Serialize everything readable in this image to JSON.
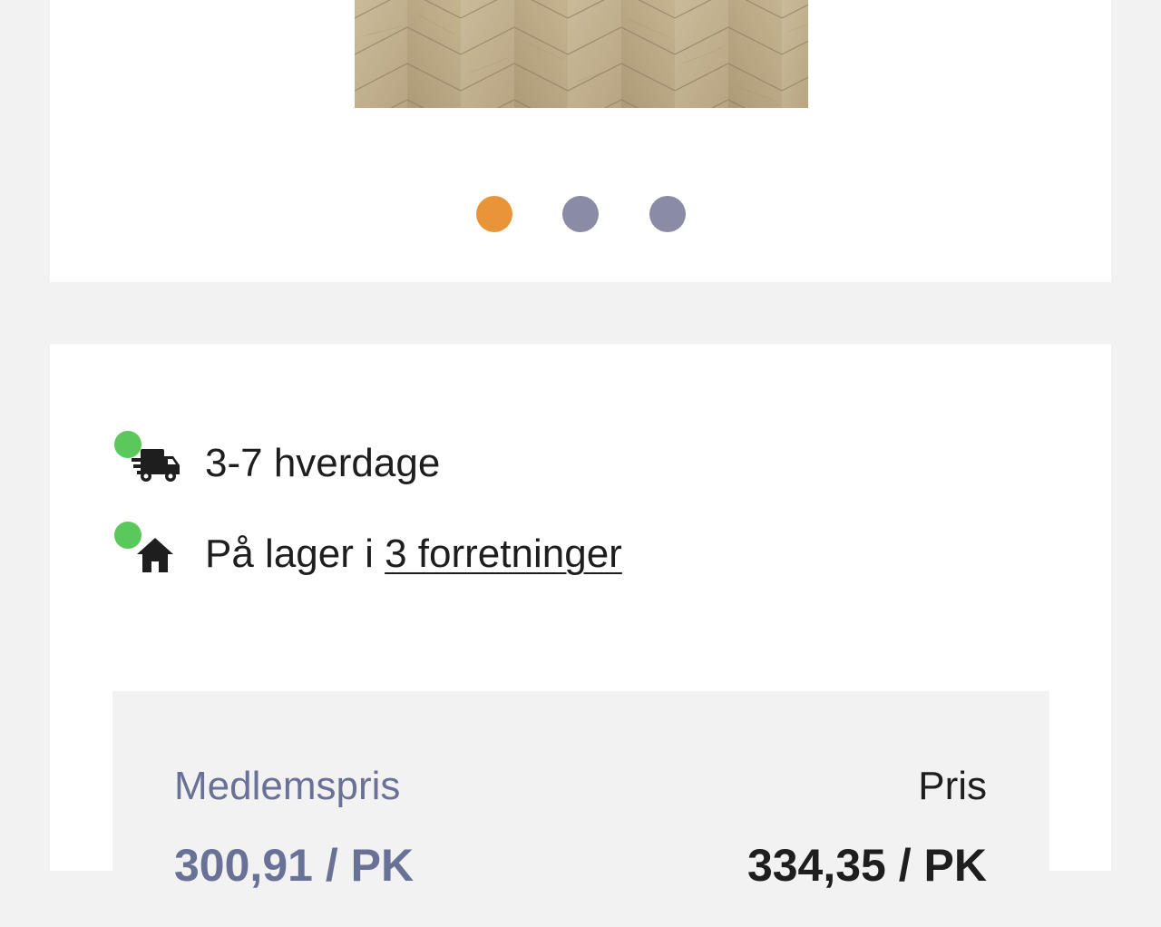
{
  "gallery": {
    "image_alt": "Herringbone oak floor",
    "dots": [
      {
        "active": true,
        "color": "#e8953a"
      },
      {
        "active": false,
        "color": "#8a8ca6"
      },
      {
        "active": false,
        "color": "#8a8ca6"
      }
    ]
  },
  "availability": {
    "status_color": "#5ac85a",
    "delivery": {
      "icon": "truck-icon",
      "text": "3-7 hverdage"
    },
    "stock": {
      "icon": "house-icon",
      "prefix": "På lager i ",
      "link_text": "3 forretninger"
    }
  },
  "pricing": {
    "member_label": "Medlemspris",
    "member_price": "300,91 / PK",
    "price_label": "Pris",
    "price": "334,35 / PK",
    "member_color": "#6a7196"
  }
}
